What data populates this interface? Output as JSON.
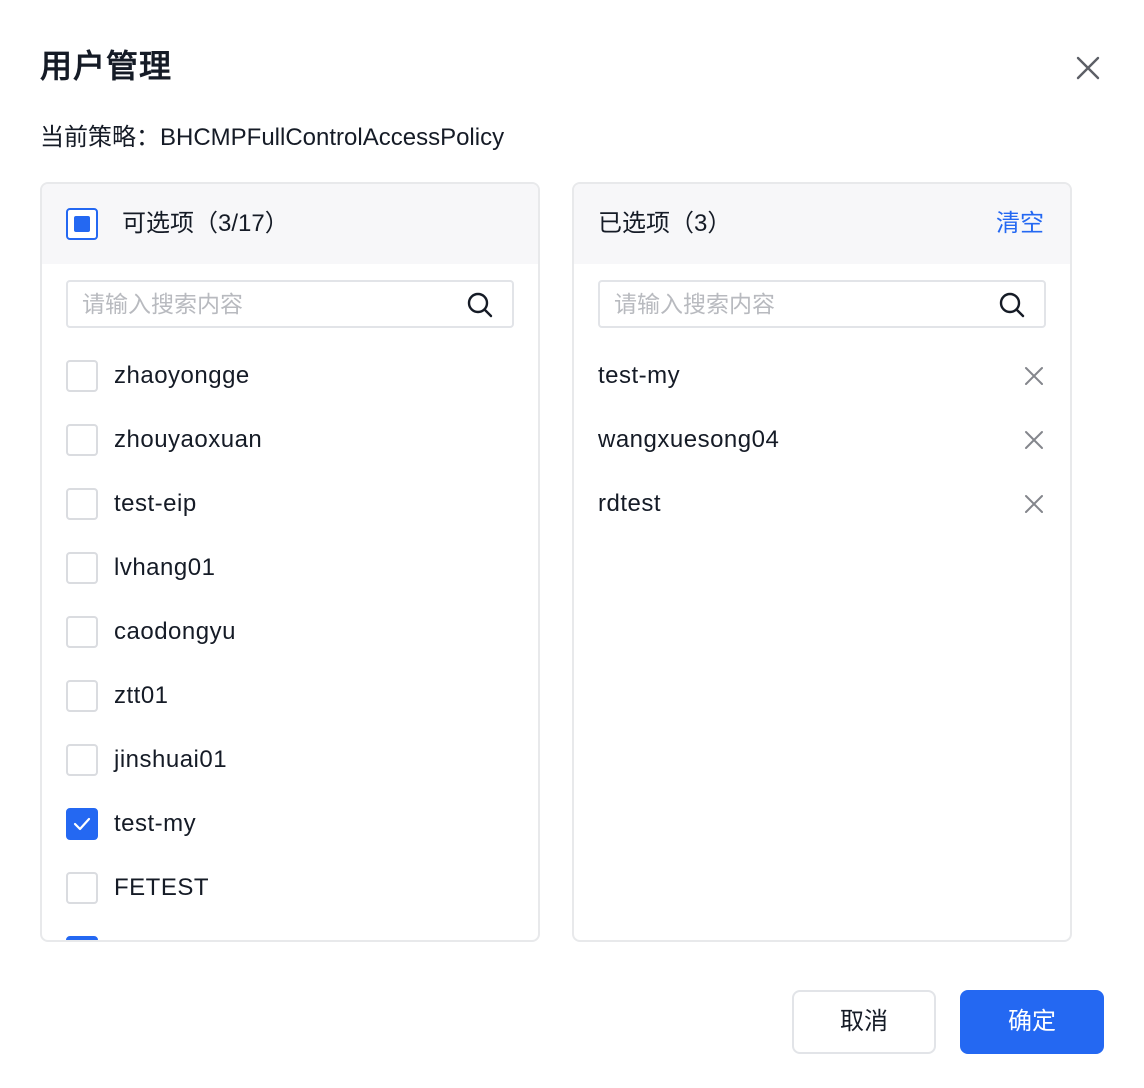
{
  "dialog": {
    "title": "用户管理",
    "policy_text": "当前策略：BHCMPFullControlAccessPolicy"
  },
  "left_panel": {
    "header": "可选项（3/17）",
    "search_placeholder": "请输入搜索内容",
    "items": [
      {
        "label": "zhaoyongge",
        "checked": false
      },
      {
        "label": "zhouyaoxuan",
        "checked": false
      },
      {
        "label": "test-eip",
        "checked": false
      },
      {
        "label": "lvhang01",
        "checked": false
      },
      {
        "label": "caodongyu",
        "checked": false
      },
      {
        "label": "ztt01",
        "checked": false
      },
      {
        "label": "jinshuai01",
        "checked": false
      },
      {
        "label": "test-my",
        "checked": true
      },
      {
        "label": "FETEST",
        "checked": false
      },
      {
        "label": "",
        "checked": true
      }
    ]
  },
  "right_panel": {
    "header": "已选项（3）",
    "clear_label": "清空",
    "search_placeholder": "请输入搜索内容",
    "items": [
      {
        "label": "test-my"
      },
      {
        "label": "wangxuesong04"
      },
      {
        "label": "rdtest"
      }
    ]
  },
  "footer": {
    "cancel_label": "取消",
    "ok_label": "确定"
  },
  "colors": {
    "accent": "#2468f2",
    "border": "#e8e9eb",
    "header_bg": "#f7f7f9",
    "text": "#151b26",
    "placeholder": "#b8babf"
  }
}
